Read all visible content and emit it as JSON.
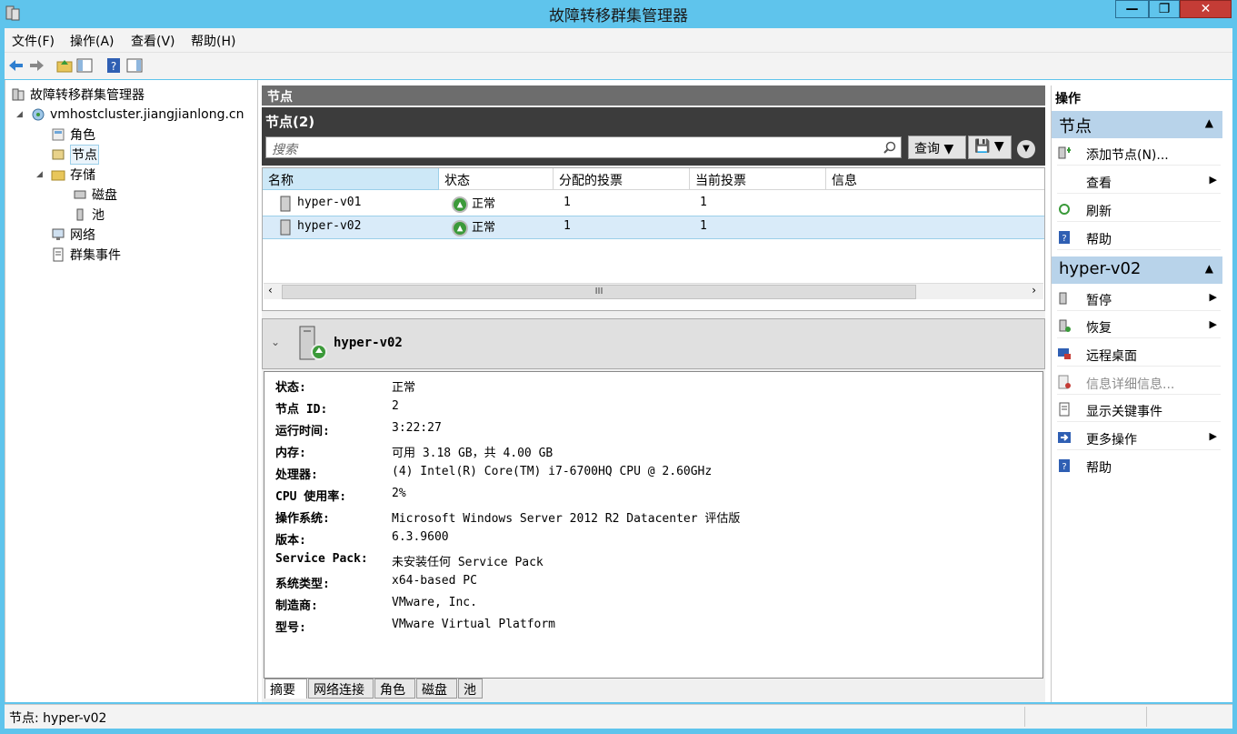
{
  "window": {
    "title": "故障转移群集管理器",
    "minimize": "—",
    "maximize": "❐",
    "close": "✕"
  },
  "menu": [
    "文件(F)",
    "操作(A)",
    "查看(V)",
    "帮助(H)"
  ],
  "tree": {
    "root": "故障转移群集管理器",
    "cluster": "vmhostcluster.jiangjianlong.cn",
    "roles": "角色",
    "nodes": "节点",
    "storage": "存储",
    "disks": "磁盘",
    "pools": "池",
    "networks": "网络",
    "events": "群集事件"
  },
  "center": {
    "header": "节点",
    "subheader": "节点(2)",
    "search_placeholder": "搜索",
    "query_button": "查询",
    "columns": [
      "名称",
      "状态",
      "分配的投票",
      "当前投票",
      "信息"
    ],
    "rows": [
      {
        "name": "hyper-v01",
        "status": "正常",
        "assigned": "1",
        "current": "1",
        "info": ""
      },
      {
        "name": "hyper-v02",
        "status": "正常",
        "assigned": "1",
        "current": "1",
        "info": ""
      }
    ],
    "scroll_thumb": "III"
  },
  "detail": {
    "node_name": "hyper-v02",
    "fields": [
      {
        "k": "状态:",
        "v": "正常"
      },
      {
        "k": "节点 ID:",
        "v": "2"
      },
      {
        "k": "运行时间:",
        "v": "3:22:27"
      },
      {
        "k": "内存:",
        "v": "可用 3.18 GB，共 4.00 GB"
      },
      {
        "k": "处理器:",
        "v": "(4) Intel(R) Core(TM) i7-6700HQ CPU @ 2.60GHz"
      },
      {
        "k": "CPU 使用率:",
        "v": "2%"
      },
      {
        "k": "操作系统:",
        "v": "Microsoft Windows Server 2012 R2 Datacenter 评估版"
      },
      {
        "k": "版本:",
        "v": "6.3.9600"
      },
      {
        "k": "Service Pack:",
        "v": "未安装任何 Service Pack"
      },
      {
        "k": "系统类型:",
        "v": "x64-based PC"
      },
      {
        "k": "制造商:",
        "v": "VMware, Inc."
      },
      {
        "k": "型号:",
        "v": "VMware Virtual Platform"
      }
    ],
    "tabs": [
      "摘要",
      "网络连接",
      "角色",
      "磁盘",
      "池"
    ]
  },
  "actions": {
    "title": "操作",
    "section1": "节点",
    "section1_items": [
      "添加节点(N)...",
      "查看",
      "刷新",
      "帮助"
    ],
    "section2": "hyper-v02",
    "section2_items": [
      "暂停",
      "恢复",
      "远程桌面",
      "信息详细信息...",
      "显示关键事件",
      "更多操作",
      "帮助"
    ]
  },
  "status": {
    "text": "节点:  hyper-v02"
  },
  "colors": {
    "titlebar": "#5fc4ec",
    "selection": "#d9ebf9",
    "header_dark": "#3c3c3c",
    "action_section": "#b8d3ea",
    "ok_green": "#3c9a3a"
  }
}
